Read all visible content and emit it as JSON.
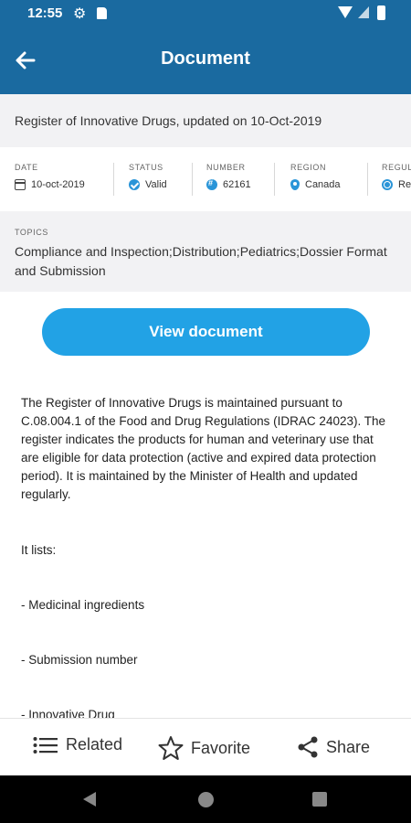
{
  "status_bar": {
    "time": "12:55",
    "icons": [
      "gear-icon",
      "sd-card-icon",
      "wifi-icon",
      "signal-icon",
      "battery-icon"
    ]
  },
  "app_bar": {
    "title": "Document",
    "back_icon": "arrow-left-icon"
  },
  "document": {
    "title": "Register of Innovative Drugs, updated on 10-Oct-2019"
  },
  "meta": {
    "date": {
      "label": "DATE",
      "value": "10-oct-2019",
      "icon": "calendar-icon"
    },
    "status": {
      "label": "STATUS",
      "value": "Valid",
      "icon": "check-circle-icon"
    },
    "number": {
      "label": "NUMBER",
      "value": "62161",
      "icon": "hash-icon"
    },
    "region": {
      "label": "REGION",
      "value": "Canada",
      "icon": "location-pin-icon"
    },
    "regulatory": {
      "label": "REGUL",
      "value": "Re",
      "icon": "globe-icon"
    }
  },
  "topics": {
    "label": "TOPICS",
    "value": "Compliance and Inspection;Distribution;Pediatrics;Dossier Format and Submission"
  },
  "view_button": {
    "label": "View document"
  },
  "body": {
    "paragraph": "The Register of Innovative Drugs is maintained pursuant to C.08.004.1 of the Food and Drug Regulations (IDRAC 24023). The register indicates the products for human and veterinary use that are eligible for data protection (active and expired data protection period). It is maintained by the Minister of Health and updated regularly.",
    "lists_intro": "It lists:",
    "items": [
      "- Medicinal ingredients",
      "- Submission number",
      "- Innovative Drug"
    ]
  },
  "bottom_nav": {
    "related": "Related",
    "favorite": "Favorite",
    "share": "Share"
  },
  "colors": {
    "app_bar": "#1a6aa0",
    "accent": "#22a2e5",
    "band": "#f2f2f4"
  }
}
